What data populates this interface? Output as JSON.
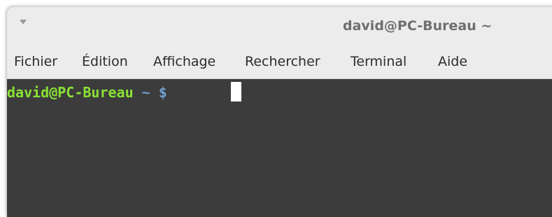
{
  "window": {
    "title": "david@PC-Bureau ~"
  },
  "menu": {
    "items": [
      "Fichier",
      "Édition",
      "Affichage",
      "Rechercher",
      "Terminal",
      "Aide"
    ]
  },
  "terminal": {
    "user_host": "david@PC-Bureau",
    "path_symbol": "~ $"
  },
  "colors": {
    "titlebar_bg": "#ececec",
    "terminal_bg": "#3c3c3c",
    "prompt_user": "#8ae234",
    "prompt_path": "#729fcf"
  },
  "icons": {
    "window_menu": "triangle-down-icon"
  }
}
